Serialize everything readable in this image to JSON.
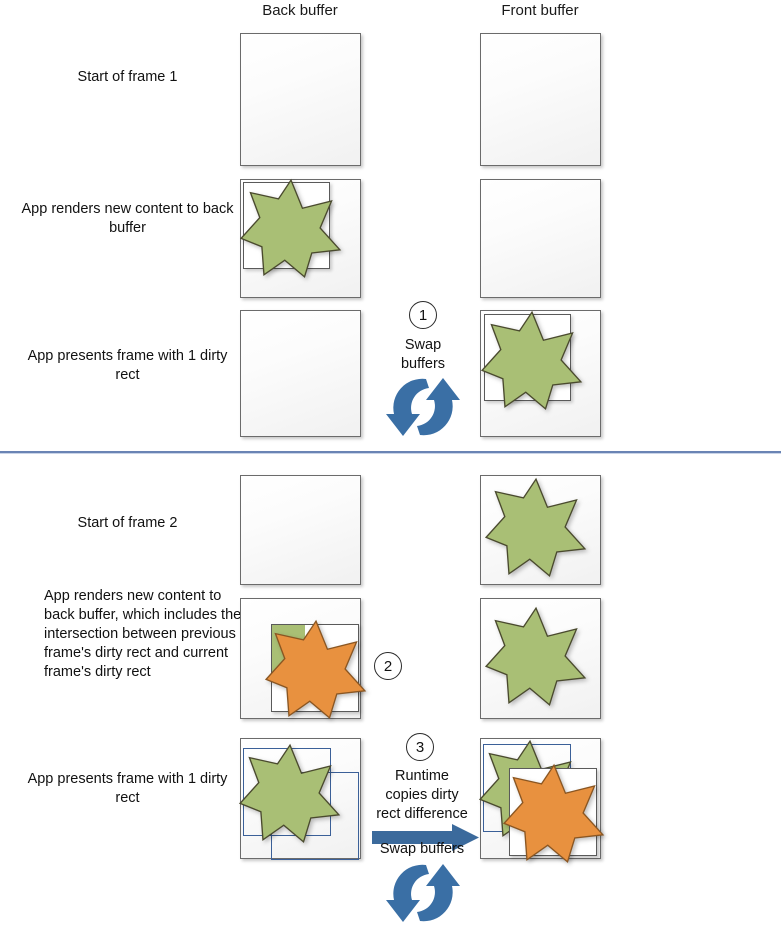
{
  "title": "Double-buffered presentation with dirty rects",
  "colors": {
    "green_star": "#a9bf75",
    "orange_star": "#e8913f",
    "star_outline": "#4a4a2e",
    "orange_outline": "#8a5622",
    "buffer_border": "#6b6b6b",
    "dirty_rect_blue": "#3b6098",
    "divider_blue": "#6a84b4",
    "swap_arrow_blue": "#3a6fa5",
    "copy_arrow_blue": "#3b6a9c"
  },
  "columns": {
    "back_buffer": "Back buffer",
    "front_buffer": "Front buffer"
  },
  "rows": [
    {
      "id": "frame1-start",
      "label": "Start of frame 1",
      "align": "center"
    },
    {
      "id": "frame1-render",
      "label": "App renders new\ncontent to back buffer",
      "align": "center"
    },
    {
      "id": "frame1-present",
      "label": "App presents frame\nwith 1 dirty rect",
      "align": "center"
    },
    {
      "id": "frame2-start",
      "label": "Start of frame 2",
      "align": "center"
    },
    {
      "id": "frame2-render",
      "label": "App renders new\ncontent to back buffer,\nwhich includes the\nintersection between\nprevious frame's dirty\nrect and current\nframe's dirty rect",
      "align": "left"
    },
    {
      "id": "frame2-present",
      "label": "App presents frame\nwith 1 dirty rect",
      "align": "center"
    }
  ],
  "steps": [
    {
      "number": "1",
      "text": "Swap\nbuffers",
      "icon": "swap-buffers-icon"
    },
    {
      "number": "2",
      "text": "",
      "icon": ""
    },
    {
      "number": "3",
      "text": "Runtime\ncopies dirty\nrect difference",
      "text2": "Swap buffers",
      "icon": "swap-buffers-icon",
      "arrow": "copy-arrow-icon"
    }
  ],
  "buffer_contents": {
    "frame1_start_back": "empty",
    "frame1_start_front": "empty",
    "frame1_render_back": "green star in dirty rect",
    "frame1_render_front": "empty",
    "frame1_present_back": "empty",
    "frame1_present_front": "green star in dirty rect",
    "frame2_start_back": "empty",
    "frame2_start_front": "green star",
    "frame2_render_back": "orange star over green intersection patch in dirty rect",
    "frame2_render_front": "green star",
    "frame2_present_back": "green star with two blue dirty rects",
    "frame2_present_front": "green star and orange star with blue and grey dirty rects"
  }
}
